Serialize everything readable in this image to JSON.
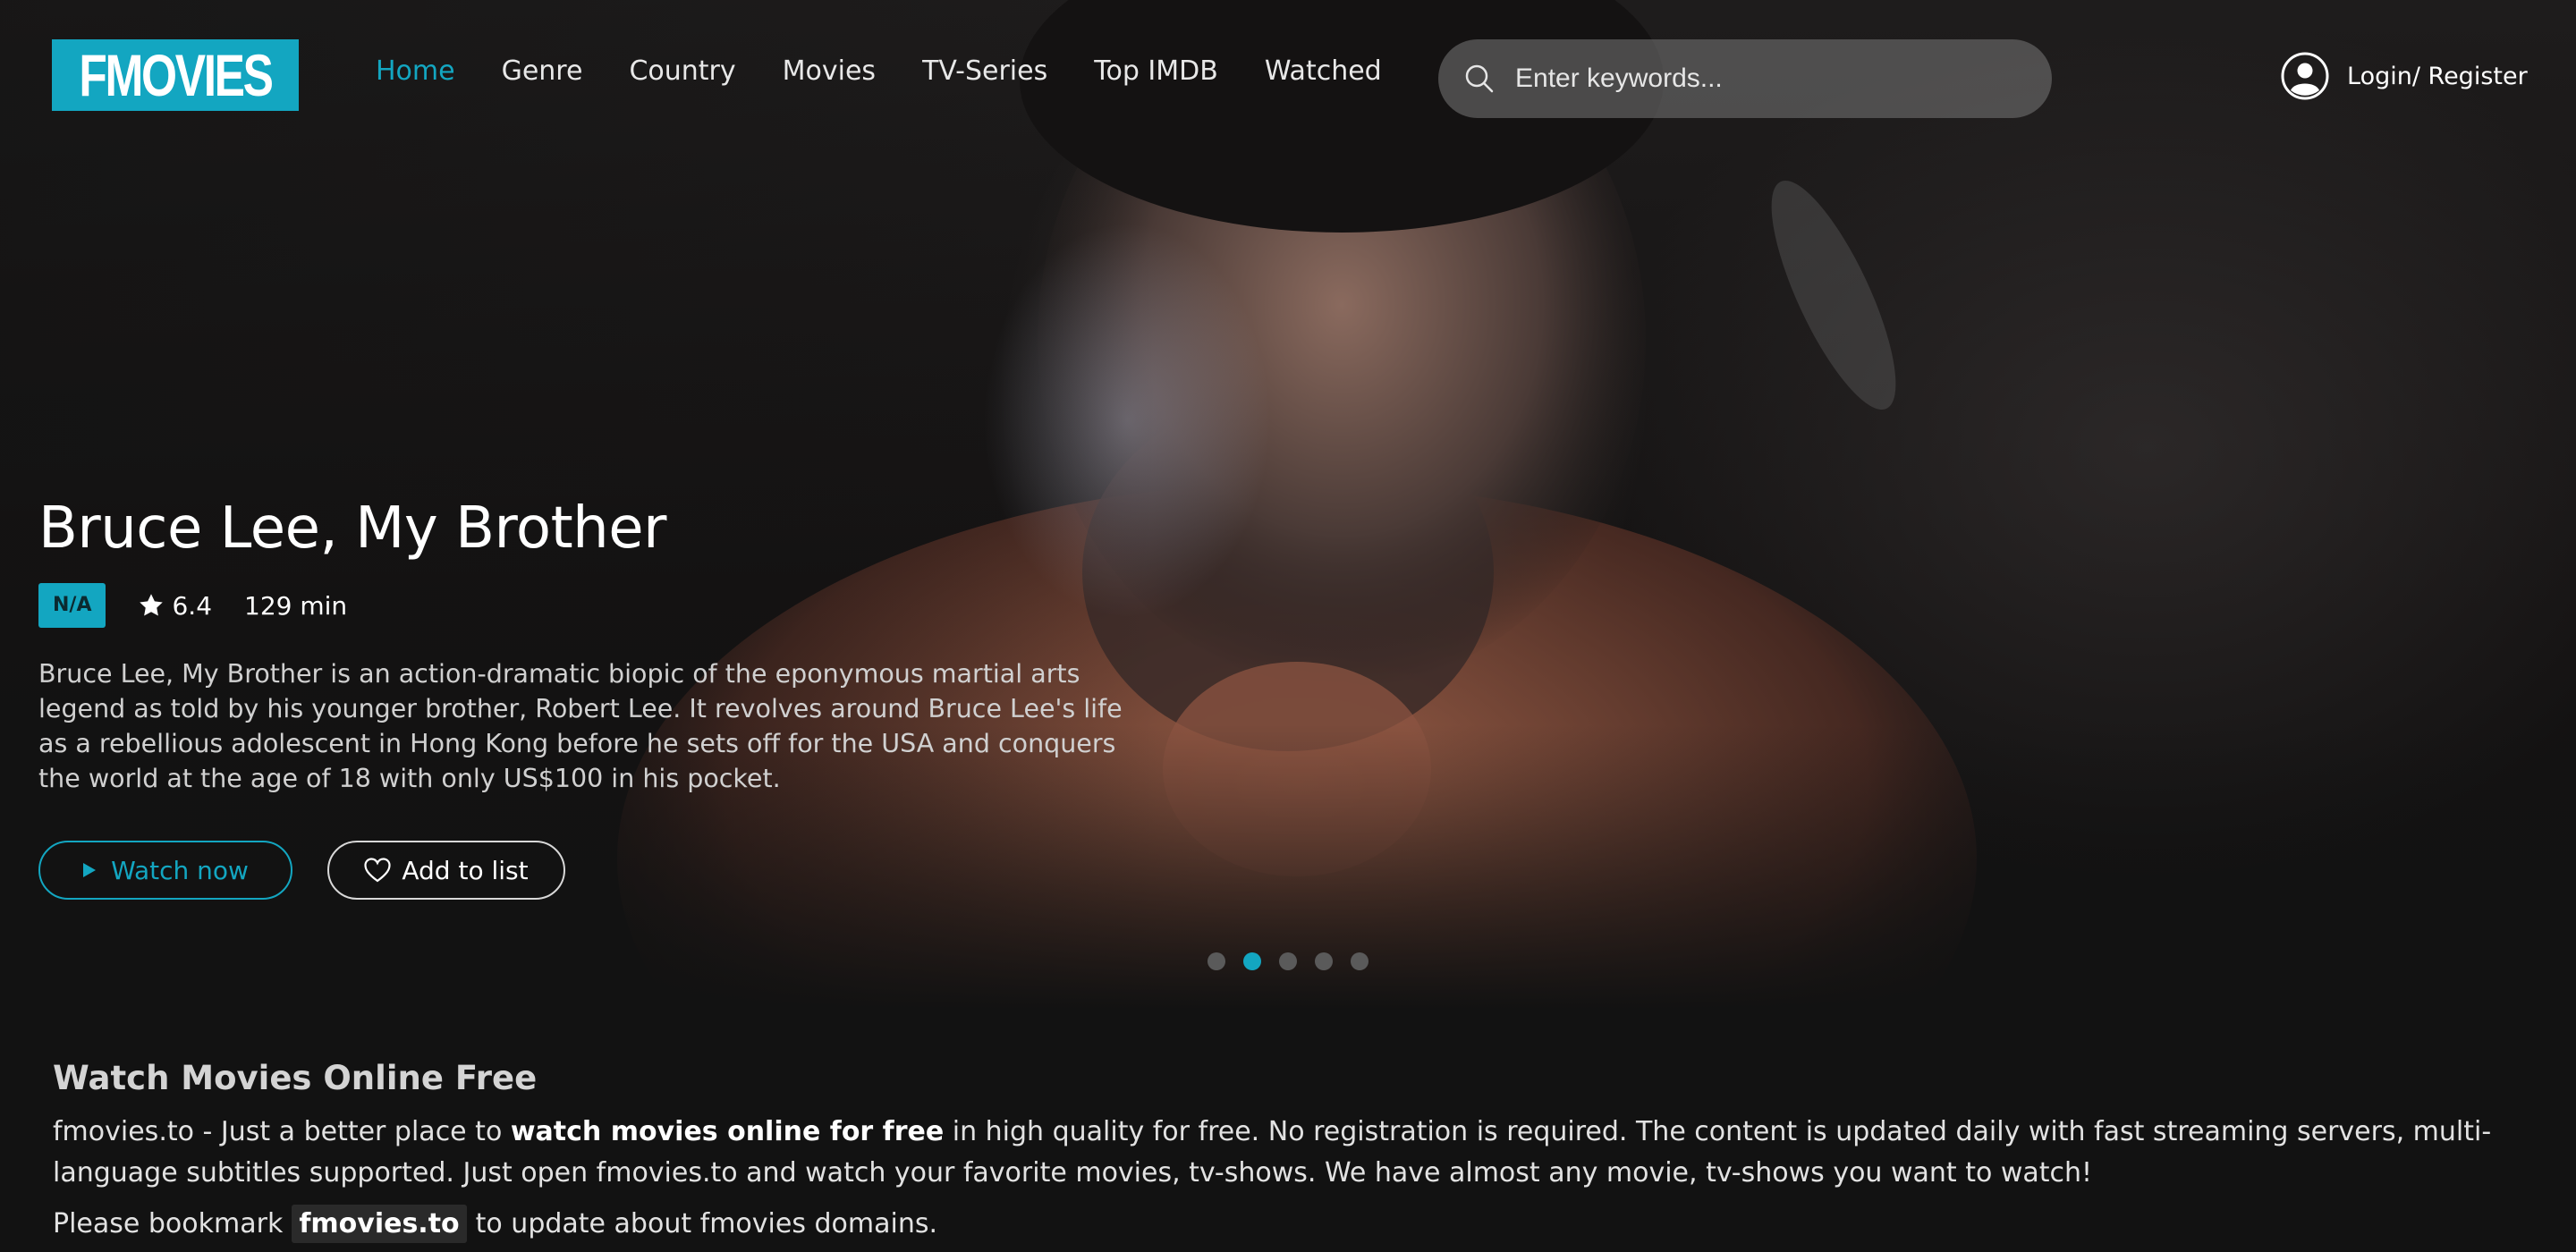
{
  "header": {
    "logo_text": "FMOVIES",
    "nav": [
      {
        "label": "Home",
        "active": true
      },
      {
        "label": "Genre",
        "active": false
      },
      {
        "label": "Country",
        "active": false
      },
      {
        "label": "Movies",
        "active": false
      },
      {
        "label": "TV-Series",
        "active": false
      },
      {
        "label": "Top IMDB",
        "active": false
      },
      {
        "label": "Watched",
        "active": false
      }
    ],
    "search": {
      "placeholder": "Enter keywords...",
      "value": "",
      "icon": "search-icon"
    },
    "login_label": "Login/ Register",
    "login_icon": "user-circle-icon"
  },
  "featured": {
    "title": "Bruce Lee, My Brother",
    "quality": "N/A",
    "rating": "6.4",
    "duration": "129 min",
    "description": "Bruce Lee, My Brother is an action-dramatic biopic of the eponymous martial arts legend as told by his younger brother, Robert Lee. It revolves around Bruce Lee's life as a rebellious adolescent in Hong Kong before he sets off for the USA and conquers the world at the age of 18 with only US$100 in his pocket.",
    "watch_label": "Watch now",
    "add_label": "Add to list",
    "slides_total": 5,
    "active_slide": 2
  },
  "info": {
    "title": "Watch Movies Online Free",
    "text_before": "fmovies.to - Just a better place to ",
    "text_bold": "watch movies online for free",
    "text_after": " in high quality for free. No registration is required. The content is updated daily with fast streaming servers, multi-language subtitles supported. Just open fmovies.to and watch your favorite movies, tv-shows. We have almost any movie, tv-shows you want to watch!",
    "bookmark_before": "Please bookmark",
    "bookmark_domain": "fmovies.to",
    "bookmark_after": "to update about fmovies domains."
  },
  "colors": {
    "accent": "#13a6c1",
    "background": "#121212"
  }
}
